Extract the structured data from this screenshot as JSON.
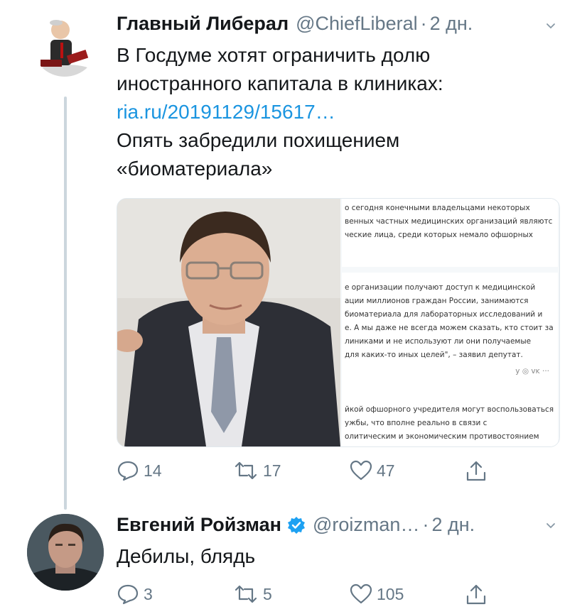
{
  "tweet1": {
    "display_name": "Главный Либерал",
    "handle": "@ChiefLiberal",
    "separator": "·",
    "time": "2 дн.",
    "text_line1": "В Госдуме хотят ограничить долю",
    "text_line2": "иностранного капитала в клиниках:",
    "link_text": "ria.ru/20191129/15617…",
    "text_line4": "Опять забредили похищением",
    "text_line5": "«биоматериала»",
    "article_lines_1": [
      "о сегодня конечными владельцами некоторых",
      "венных частных медицинских организаций являютс",
      "ческие лица, среди которых немало офшорных"
    ],
    "article_lines_2": [
      "е организации получают доступ к медицинской",
      "ации миллионов граждан России, занимаются",
      "биоматериала для лабораторных исследований и",
      "е. А мы даже не всегда можем сказать, кто стоит за",
      "линиками и не используют ли они получаемые",
      "для каких-то иных целей\", – заявил депутат."
    ],
    "article_share_icons": "у  ◎  ᴠᴋ  ···",
    "article_lines_3": [
      "йкой офшорного учредителя могут воспользоваться",
      "ужбы, что вполне реально в связи с",
      "олитическим и экономическим противостоянием"
    ],
    "replies": "14",
    "retweets": "17",
    "likes": "47"
  },
  "tweet2": {
    "display_name": "Евгений Ройзман",
    "handle": "@roizman…",
    "separator": "·",
    "time": "2 дн.",
    "text": "Дебилы, блядь",
    "replies": "3",
    "retweets": "5",
    "likes": "105"
  },
  "icons": {
    "reply": "reply-icon",
    "retweet": "retweet-icon",
    "like": "heart-icon",
    "share": "share-icon",
    "caret": "chevron-down-icon",
    "verified": "verified-badge-icon"
  },
  "colors": {
    "link": "#1b95e0",
    "muted": "#657786",
    "verified": "#1da1f2",
    "thread_line": "#ccd6dd"
  }
}
